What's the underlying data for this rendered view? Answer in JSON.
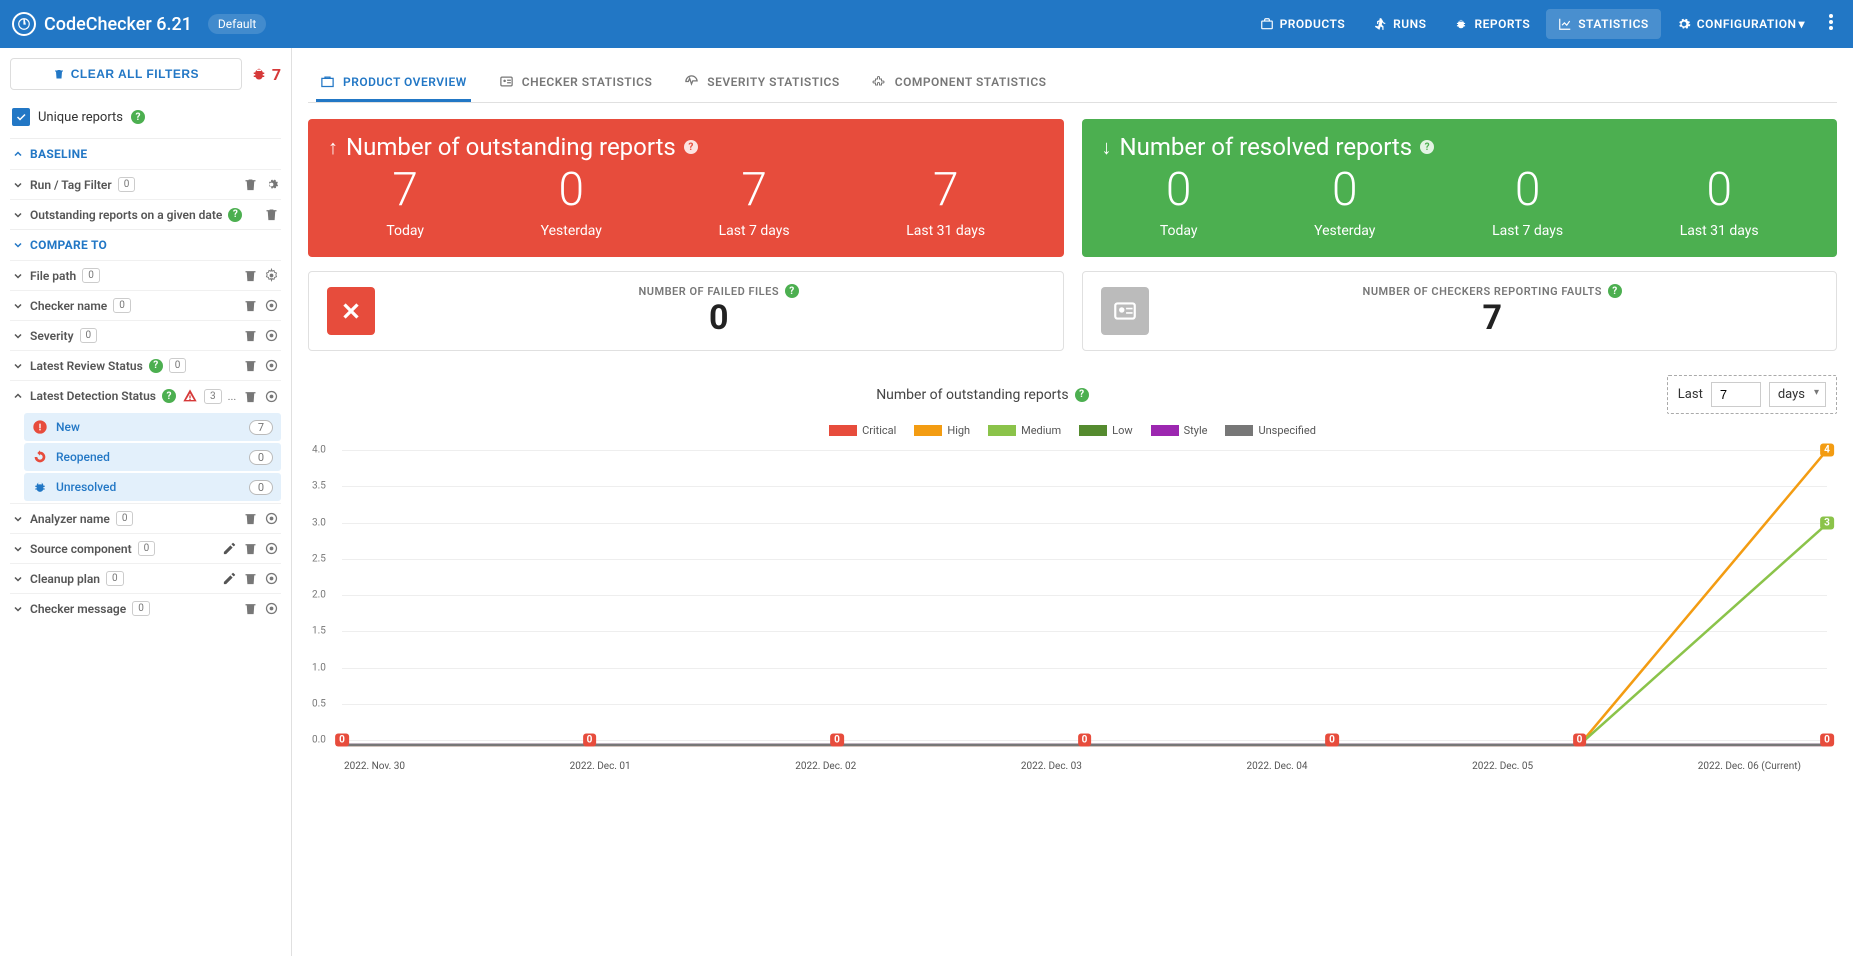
{
  "header": {
    "app_name": "CodeChecker 6.21",
    "chip": "Default",
    "nav": {
      "products": "PRODUCTS",
      "runs": "RUNS",
      "reports": "REPORTS",
      "statistics": "STATISTICS",
      "configuration": "CONFIGURATION"
    }
  },
  "sidebar": {
    "clear_filters": "CLEAR ALL FILTERS",
    "bug_count": "7",
    "unique_reports": "Unique reports",
    "sections": {
      "baseline": "BASELINE",
      "compare_to": "COMPARE TO"
    },
    "filters": {
      "run_tag": {
        "label": "Run / Tag Filter",
        "count": "0"
      },
      "outstanding_date": {
        "label": "Outstanding reports on a given date"
      },
      "file_path": {
        "label": "File path",
        "count": "0"
      },
      "checker_name": {
        "label": "Checker name",
        "count": "0"
      },
      "severity": {
        "label": "Severity",
        "count": "0"
      },
      "latest_review": {
        "label": "Latest Review Status",
        "count": "0"
      },
      "latest_detection": {
        "label": "Latest Detection Status",
        "count": "3"
      },
      "analyzer_name": {
        "label": "Analyzer name",
        "count": "0"
      },
      "source_component": {
        "label": "Source component",
        "count": "0"
      },
      "cleanup_plan": {
        "label": "Cleanup plan",
        "count": "0"
      },
      "checker_message": {
        "label": "Checker message",
        "count": "0"
      }
    },
    "detection_status": {
      "new": {
        "label": "New",
        "count": "7"
      },
      "reopened": {
        "label": "Reopened",
        "count": "0"
      },
      "unresolved": {
        "label": "Unresolved",
        "count": "0"
      }
    }
  },
  "tabs": {
    "product": "PRODUCT OVERVIEW",
    "checker": "CHECKER STATISTICS",
    "severity": "SEVERITY STATISTICS",
    "component": "COMPONENT STATISTICS"
  },
  "cards": {
    "outstanding": {
      "title": "Number of outstanding reports",
      "today": {
        "val": "7",
        "label": "Today"
      },
      "yesterday": {
        "val": "0",
        "label": "Yesterday"
      },
      "last7": {
        "val": "7",
        "label": "Last 7 days"
      },
      "last31": {
        "val": "7",
        "label": "Last 31 days"
      }
    },
    "resolved": {
      "title": "Number of resolved reports",
      "today": {
        "val": "0",
        "label": "Today"
      },
      "yesterday": {
        "val": "0",
        "label": "Yesterday"
      },
      "last7": {
        "val": "0",
        "label": "Last 7 days"
      },
      "last31": {
        "val": "0",
        "label": "Last 31 days"
      }
    },
    "failed_files": {
      "label": "NUMBER OF FAILED FILES",
      "val": "0"
    },
    "checkers_faults": {
      "label": "NUMBER OF CHECKERS REPORTING FAULTS",
      "val": "7"
    }
  },
  "chart": {
    "title": "Number of outstanding reports",
    "range_prefix": "Last",
    "range_value": "7",
    "range_unit": "days",
    "legend": {
      "critical": "Critical",
      "high": "High",
      "medium": "Medium",
      "low": "Low",
      "style": "Style",
      "unspecified": "Unspecified"
    },
    "y_ticks": [
      "0.0",
      "0.5",
      "1.0",
      "1.5",
      "2.0",
      "2.5",
      "3.0",
      "3.5",
      "4.0"
    ],
    "x_ticks": [
      "2022. Nov. 30",
      "2022. Dec. 01",
      "2022. Dec. 02",
      "2022. Dec. 03",
      "2022. Dec. 04",
      "2022. Dec. 05",
      "2022. Dec. 06 (Current)"
    ]
  },
  "chart_data": {
    "type": "line",
    "title": "Number of outstanding reports",
    "xlabel": "",
    "ylabel": "",
    "ylim": [
      0,
      4
    ],
    "categories": [
      "2022. Nov. 30",
      "2022. Dec. 01",
      "2022. Dec. 02",
      "2022. Dec. 03",
      "2022. Dec. 04",
      "2022. Dec. 05",
      "2022. Dec. 06 (Current)"
    ],
    "series": [
      {
        "name": "Critical",
        "color": "#e74c3c",
        "values": [
          0,
          0,
          0,
          0,
          0,
          0,
          0
        ]
      },
      {
        "name": "High",
        "color": "#f39c12",
        "values": [
          0,
          0,
          0,
          0,
          0,
          0,
          4
        ]
      },
      {
        "name": "Medium",
        "color": "#8bc34a",
        "values": [
          0,
          0,
          0,
          0,
          0,
          0,
          3
        ]
      },
      {
        "name": "Low",
        "color": "#558b2f",
        "values": [
          0,
          0,
          0,
          0,
          0,
          0,
          0
        ]
      },
      {
        "name": "Style",
        "color": "#9c27b0",
        "values": [
          0,
          0,
          0,
          0,
          0,
          0,
          0
        ]
      },
      {
        "name": "Unspecified",
        "color": "#777",
        "values": [
          0,
          0,
          0,
          0,
          0,
          0,
          0
        ]
      }
    ]
  }
}
